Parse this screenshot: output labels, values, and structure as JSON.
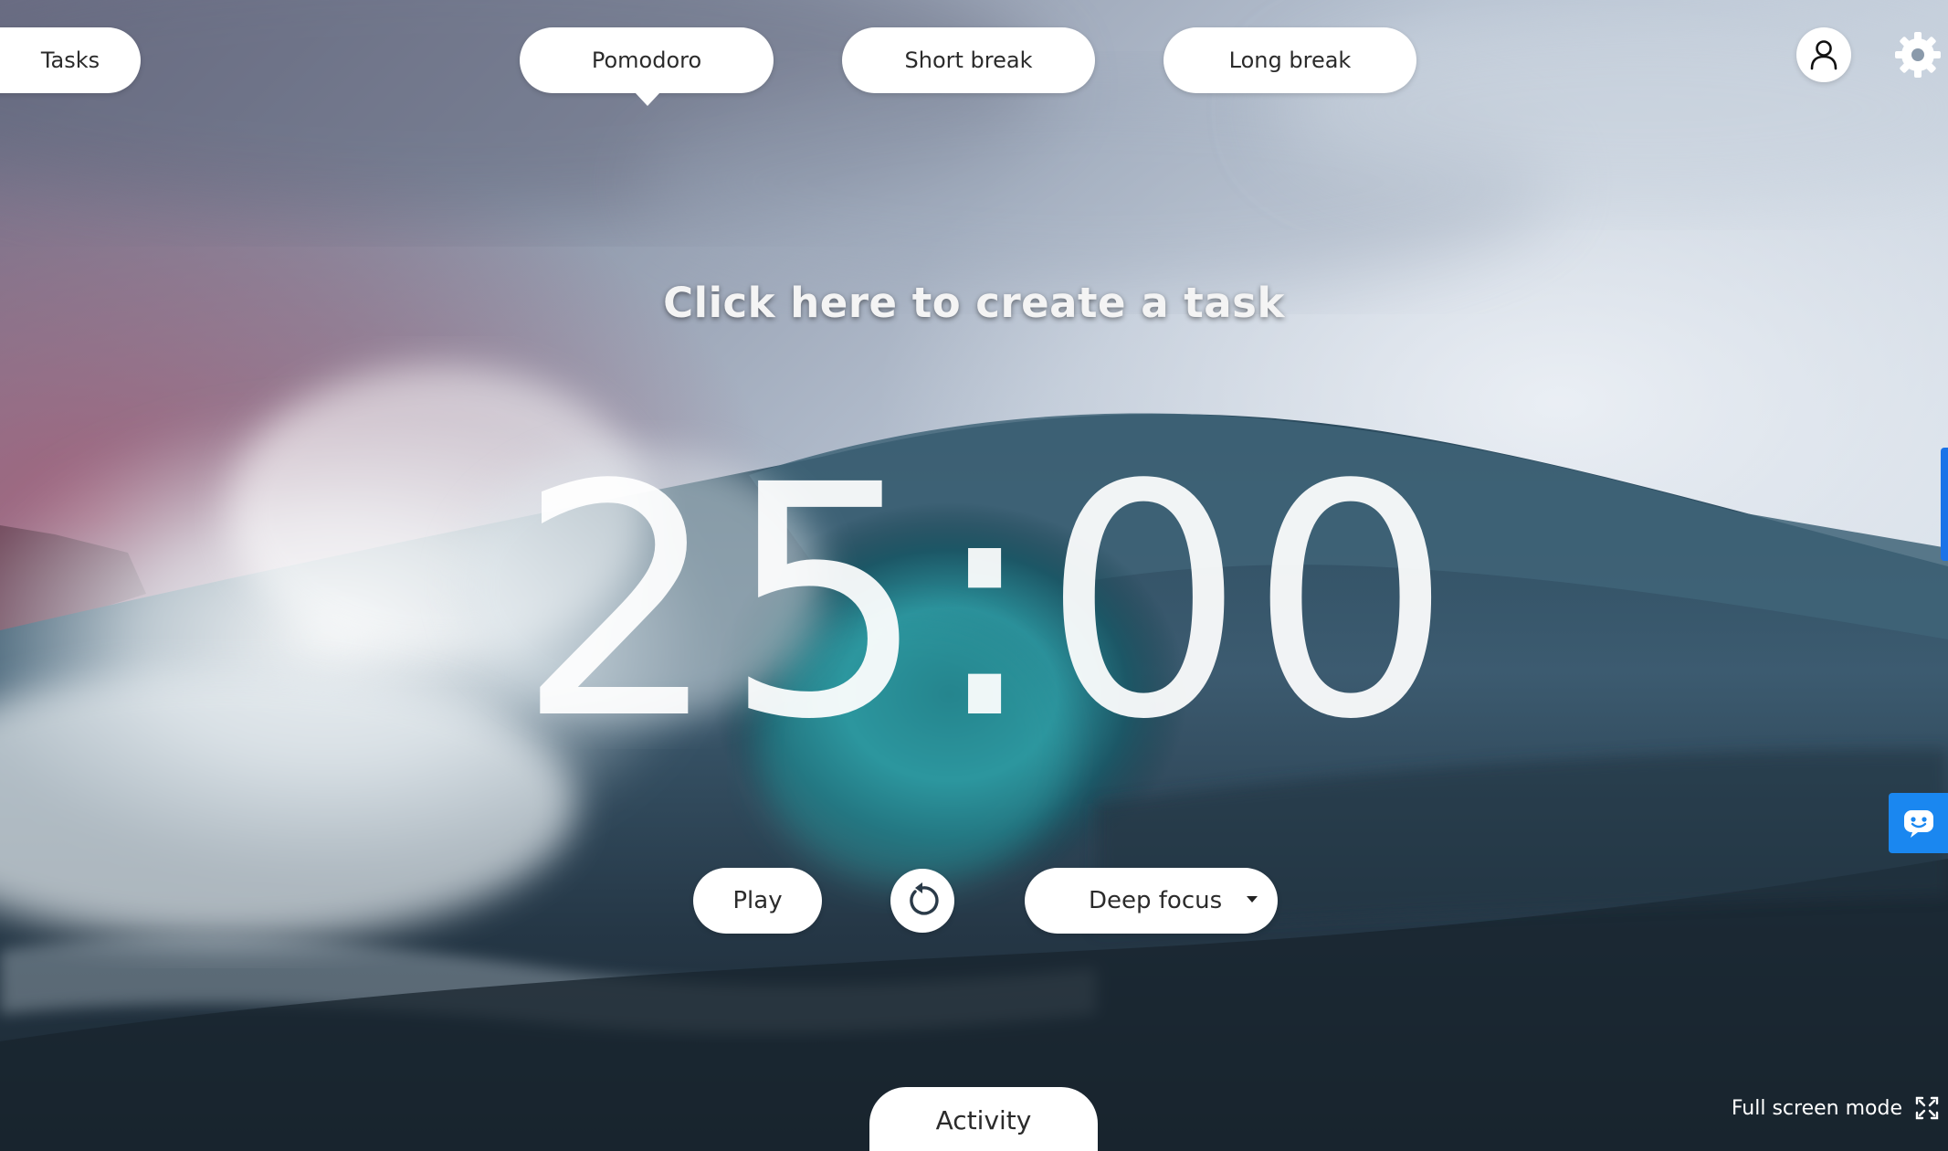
{
  "nav": {
    "tasks_label": "Tasks",
    "tabs": [
      {
        "label": "Pomodoro",
        "active": true
      },
      {
        "label": "Short break",
        "active": false
      },
      {
        "label": "Long break",
        "active": false
      }
    ],
    "icons": {
      "user": "user-icon",
      "settings": "gear-icon"
    }
  },
  "task_prompt": "Click here to create a task",
  "timer": {
    "display": "25:00"
  },
  "controls": {
    "play_label": "Play",
    "reset_icon": "reset-icon",
    "mode_selected": "Deep focus"
  },
  "activity_label": "Activity",
  "fullscreen_label": "Full screen mode",
  "colors": {
    "accent_blue": "#1a87f0",
    "pill_bg": "#ffffff",
    "timer_text": "#ffffff"
  }
}
